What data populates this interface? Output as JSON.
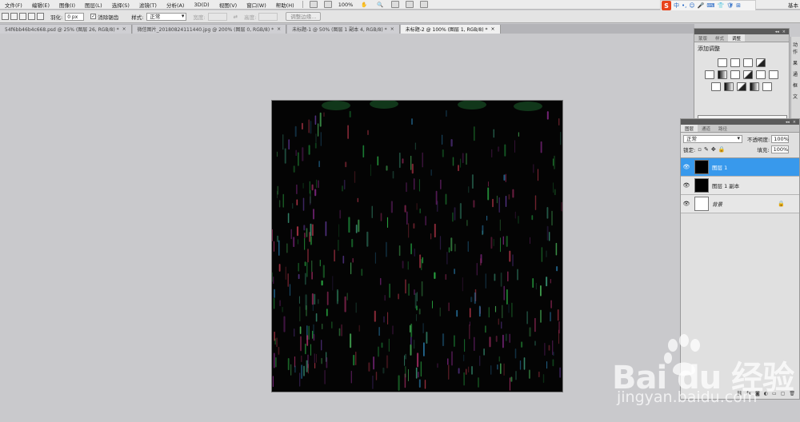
{
  "menu": {
    "items": [
      "文件(F)",
      "编辑(E)",
      "图像(I)",
      "图层(L)",
      "选择(S)",
      "滤镜(T)",
      "分析(A)",
      "3D(D)",
      "视图(V)",
      "窗口(W)",
      "帮助(H)"
    ],
    "zoom": "100%",
    "workspace": "基本"
  },
  "ime": {
    "logo": "S",
    "items": [
      "中",
      "•,",
      "☺",
      "🎤",
      "⌨",
      "👕",
      "🛡",
      "⊞"
    ]
  },
  "options": {
    "feather_label": "羽化:",
    "feather_value": "0 px",
    "antialias_label": "消除锯齿",
    "style_label": "样式:",
    "style_value": "正常",
    "width_label": "宽度:",
    "height_label": "高度:",
    "refine_edge": "调整边缘..."
  },
  "tabs": [
    {
      "label": "54f6bb46b4c668.psd @ 25% (图层 26, RGB/8) *",
      "active": false
    },
    {
      "label": "微信图片_20180824111440.jpg @ 200% (图层 0, RGB/8) *",
      "active": false
    },
    {
      "label": "未标题-1 @ 50% (图层 1 副本 4, RGB/8) *",
      "active": false
    },
    {
      "label": "未标题-2 @ 100% (图层 1, RGB/8) *",
      "active": true
    }
  ],
  "dock": [
    "动作",
    "果",
    "通",
    "框",
    "文"
  ],
  "adjust_panel": {
    "tabs": [
      "蒙版",
      "样式",
      "调整"
    ],
    "title": "添加调整"
  },
  "layers_panel": {
    "tabs": [
      "图层",
      "通道",
      "路径"
    ],
    "blend_mode": "正常",
    "opacity_label": "不透明度:",
    "opacity_value": "100%",
    "lock_label": "锁定:",
    "fill_label": "填充:",
    "fill_value": "100%",
    "layers": [
      {
        "name": "图层 1",
        "selected": true,
        "thumb": "dark"
      },
      {
        "name": "图层 1 副本",
        "selected": false,
        "thumb": "dark"
      },
      {
        "name": "背景",
        "selected": false,
        "thumb": "light",
        "locked": true
      }
    ],
    "footer_icons": [
      "link-icon",
      "fx-icon",
      "mask-icon",
      "adjustment-icon",
      "group-icon",
      "new-layer-icon",
      "trash-icon"
    ]
  },
  "watermark": {
    "brand": "Bai du 经验",
    "url": "jingyan.baidu.com"
  }
}
